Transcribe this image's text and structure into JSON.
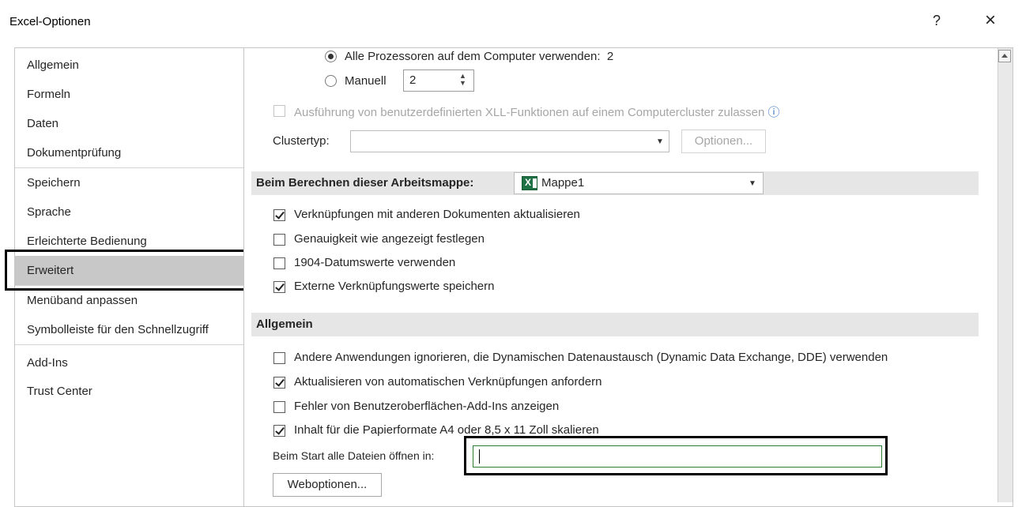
{
  "window": {
    "title": "Excel-Optionen",
    "help_label": "?",
    "close_label": "×"
  },
  "sidebar": {
    "items": [
      {
        "label": "Allgemein"
      },
      {
        "label": "Formeln"
      },
      {
        "label": "Daten"
      },
      {
        "label": "Dokumentprüfung"
      },
      {
        "label": "Speichern"
      },
      {
        "label": "Sprache"
      },
      {
        "label": "Erleichterte Bedienung"
      },
      {
        "label": "Erweitert",
        "selected": true
      },
      {
        "label": "Menüband anpassen"
      },
      {
        "label": "Symbolleiste für den Schnellzugriff"
      },
      {
        "label": "Add-Ins"
      },
      {
        "label": "Trust Center"
      }
    ]
  },
  "formulas": {
    "all_processors_label": "Alle Prozessoren auf dem Computer verwenden:",
    "all_processors_count": "2",
    "manual_label": "Manuell",
    "manual_value": "2",
    "xll_cluster_label": "Ausführung von benutzerdefinierten XLL-Funktionen auf einem Computercluster zulassen",
    "clustertype_label": "Clustertyp:",
    "options_button": "Optionen..."
  },
  "workbook": {
    "header": "Beim Berechnen dieser Arbeitsmappe:",
    "selected_workbook": "Mappe1",
    "options": [
      {
        "label": "Verknüpfungen mit anderen Dokumenten aktualisieren",
        "checked": true
      },
      {
        "label": "Genauigkeit wie angezeigt festlegen",
        "checked": false
      },
      {
        "label": "1904-Datumswerte verwenden",
        "checked": false
      },
      {
        "label": "Externe Verknüpfungswerte speichern",
        "checked": true
      }
    ]
  },
  "general": {
    "header": "Allgemein",
    "options": [
      {
        "label": "Andere Anwendungen ignorieren, die Dynamischen Datenaustausch (Dynamic Data Exchange, DDE) verwenden",
        "checked": false
      },
      {
        "label": "Aktualisieren von automatischen Verknüpfungen anfordern",
        "checked": true
      },
      {
        "label": "Fehler von Benutzeroberflächen-Add-Ins anzeigen",
        "checked": false
      },
      {
        "label": "Inhalt für die Papierformate A4 oder 8,5 x 11 Zoll skalieren",
        "checked": true
      }
    ],
    "startup_label": "Beim Start alle Dateien öffnen in:",
    "startup_value": "",
    "web_options_button": "Weboptionen..."
  },
  "icons": {
    "info": "ⓘ",
    "dropdown": "▼",
    "spin_up": "▲",
    "spin_down": "▼"
  },
  "colors": {
    "selected_nav": "#c8c8c8",
    "section_header": "#e6e6e6",
    "input_focus_border": "#2e7d32",
    "excel_green": "#1e7145"
  }
}
